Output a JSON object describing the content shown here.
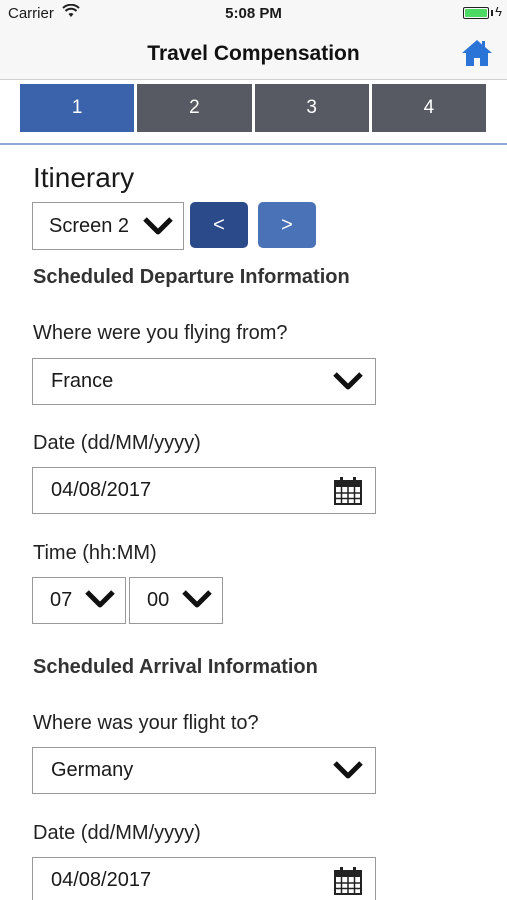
{
  "status_bar": {
    "carrier": "Carrier",
    "time": "5:08 PM",
    "battery_level": 1.0
  },
  "nav": {
    "title": "Travel Compensation",
    "home_icon": "home-icon"
  },
  "steps": {
    "items": [
      "1",
      "2",
      "3",
      "4"
    ],
    "active_index": 0
  },
  "page": {
    "heading": "Itinerary",
    "screen_select": "Screen 2",
    "prev_label": "<",
    "next_label": ">"
  },
  "departure": {
    "title": "Scheduled Departure Information",
    "from_label": "Where were you flying from?",
    "from_value": "France",
    "date_label": "Date (dd/MM/yyyy)",
    "date_value": "04/08/2017",
    "time_label": "Time (hh:MM)",
    "hour_value": "07",
    "minute_value": "00"
  },
  "arrival": {
    "title": "Scheduled Arrival Information",
    "to_label": "Where was your flight to?",
    "to_value": "Germany",
    "date_label": "Date (dd/MM/yyyy)",
    "date_value": "04/08/2017"
  },
  "colors": {
    "accent": "#3a63ab",
    "inactive_step": "#575a62",
    "home_icon": "#2a74d8"
  }
}
